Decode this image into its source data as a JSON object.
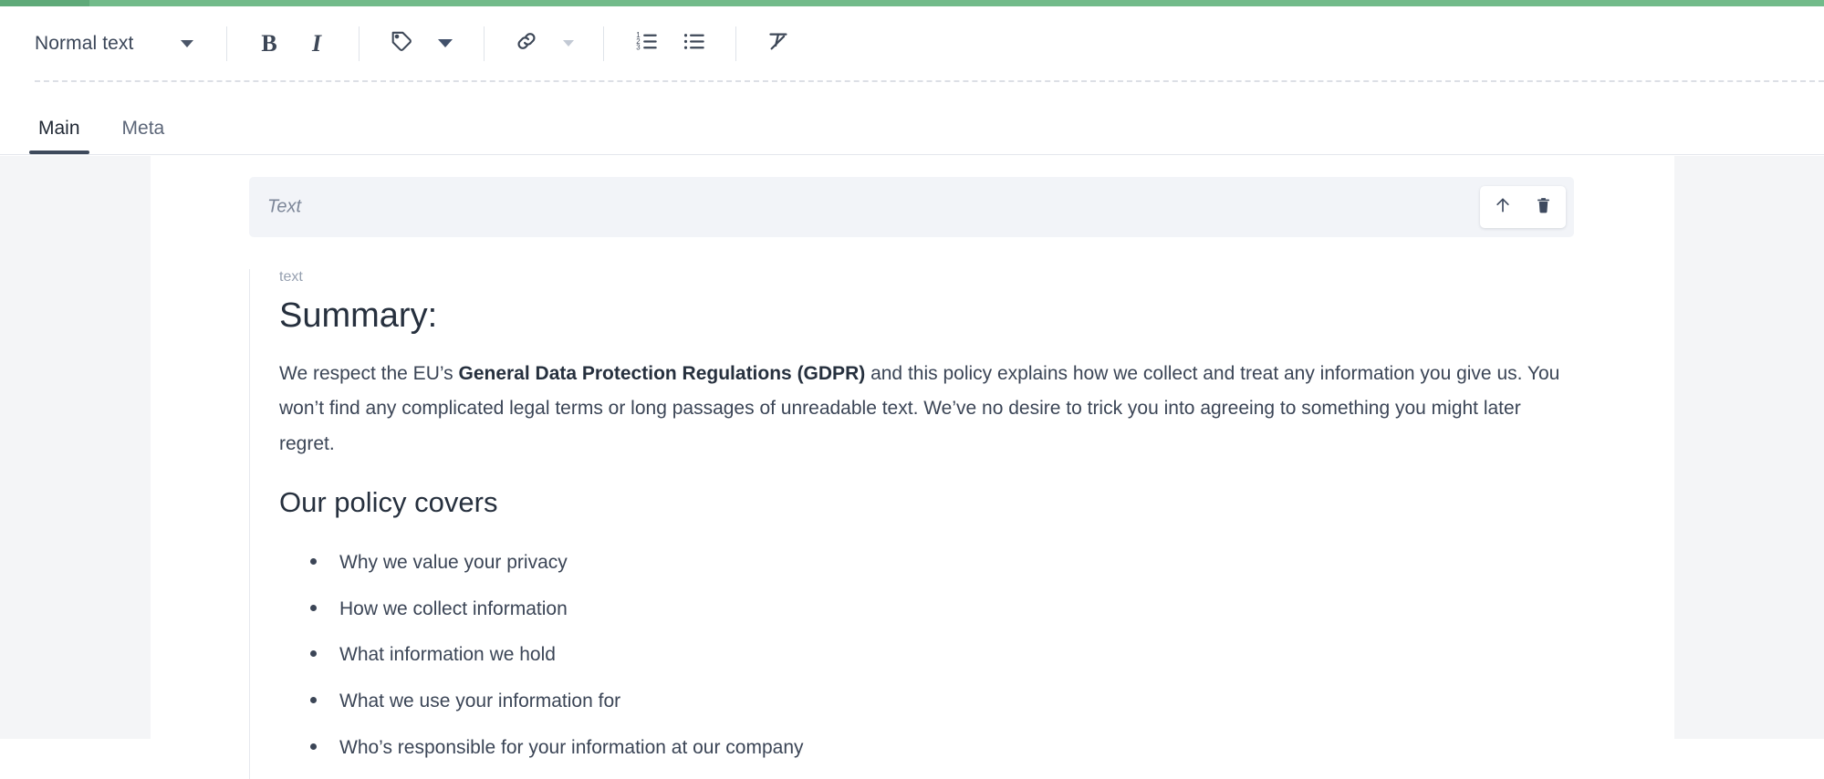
{
  "progress": {
    "bar_color": "#72bb8a",
    "segment_color": "#5faa79"
  },
  "toolbar": {
    "style_select_value": "Normal text",
    "style_select_caret": "chevron-down-icon",
    "buttons": [
      {
        "name": "bold-button",
        "glyph": "B",
        "icon": "bold-icon"
      },
      {
        "name": "italic-button",
        "glyph": "I",
        "icon": "italic-icon"
      },
      {
        "name": "tag-button",
        "glyph": "",
        "icon": "tag-icon"
      },
      {
        "name": "link-button",
        "glyph": "",
        "icon": "link-icon"
      },
      {
        "name": "numbered-list-button",
        "glyph": "",
        "icon": "numbered-list-icon"
      },
      {
        "name": "bulleted-list-button",
        "glyph": "",
        "icon": "bulleted-list-icon"
      },
      {
        "name": "clear-formatting-button",
        "glyph": "",
        "icon": "clear-formatting-icon"
      }
    ]
  },
  "tabs": [
    {
      "label": "Main",
      "active": true
    },
    {
      "label": "Meta",
      "active": false
    }
  ],
  "block": {
    "placeholder": "Text",
    "actions": [
      {
        "name": "move-up-button",
        "icon": "arrow-up-icon"
      },
      {
        "name": "delete-button",
        "icon": "trash-icon"
      }
    ]
  },
  "content": {
    "field_label": "text",
    "title": "Summary:",
    "paragraph_before_bold": "We respect the EU’s ",
    "paragraph_bold": "General Data Protection Regulations (GDPR)",
    "paragraph_after_bold": " and this policy explains how we collect and treat any information you give us. You won’t find any complicated legal terms or long passages of unreadable text. We’ve no desire to trick you into agreeing to something you might later regret.",
    "subtitle": "Our policy covers",
    "list": [
      "Why we value your privacy",
      "How we collect information",
      "What information we hold",
      "What we use your information for",
      "Who’s responsible for your information at our company"
    ]
  }
}
